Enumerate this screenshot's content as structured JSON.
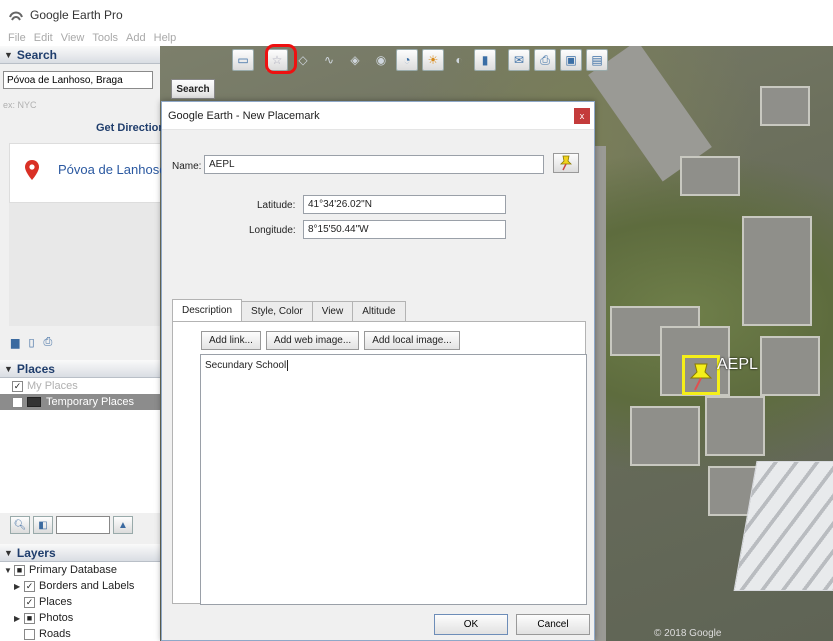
{
  "window": {
    "title": "Google Earth Pro"
  },
  "menu": [
    "File",
    "Edit",
    "View",
    "Tools",
    "Add",
    "Help"
  ],
  "search": {
    "header": "Search",
    "input_value": "Póvoa de Lanhoso, Braga",
    "button_label": "Search",
    "hint": "ex: NYC",
    "get_directions": "Get Directions",
    "result_label": "Póvoa de Lanhoso"
  },
  "places": {
    "header": "Places",
    "items": [
      "My Places",
      "Temporary Places"
    ]
  },
  "layers": {
    "header": "Layers",
    "items": [
      "Primary Database",
      "Borders and Labels",
      "Places",
      "Photos",
      "Roads"
    ]
  },
  "dialog": {
    "title": "Google Earth - New Placemark",
    "close_glyph": "x",
    "name_label": "Name:",
    "name_value": "AEPL",
    "latitude_label": "Latitude:",
    "latitude_value": "41°34'26.02\"N",
    "longitude_label": "Longitude:",
    "longitude_value": "8°15'50.44\"W",
    "tabs": [
      "Description",
      "Style, Color",
      "View",
      "Altitude"
    ],
    "buttons": {
      "add_link": "Add link...",
      "add_web_image": "Add web image...",
      "add_local_image": "Add local image..."
    },
    "description_value": "Secundary School",
    "ok_label": "OK",
    "cancel_label": "Cancel"
  },
  "map": {
    "placemark_label": "AEPL",
    "copyright": "© 2018 Google"
  },
  "colors": {
    "highlight_ring": "#e11111",
    "placemark_box": "#f4ef1a",
    "link_blue": "#2a58a0"
  }
}
